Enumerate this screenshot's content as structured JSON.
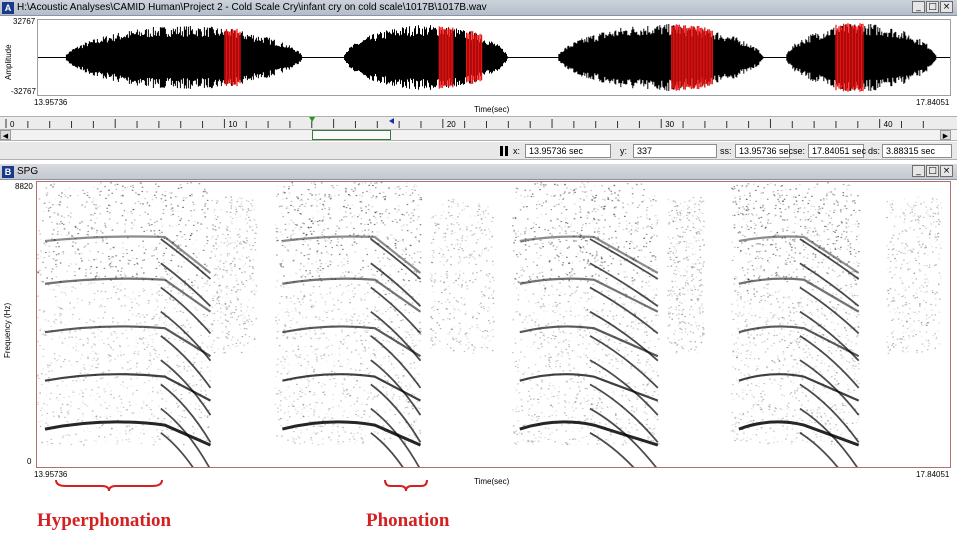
{
  "window_a": {
    "letter": "A",
    "title": "H:\\Acoustic Analyses\\CAMID Human\\Project 2 - Cold Scale Cry\\infant cry on cold scale\\1017B\\1017B.wav",
    "buttons": [
      "_",
      "□",
      "×"
    ]
  },
  "waveform": {
    "y_label": "Amplitude",
    "y_max": "32767",
    "y_min": "-32767",
    "x_start": "13.95736",
    "x_end": "17.84051",
    "x_label": "Time(sec)",
    "bursts": [
      {
        "start": 0.03,
        "end": 0.29,
        "amp": 0.9,
        "red": [
          [
            0.205,
            0.222
          ]
        ]
      },
      {
        "start": 0.335,
        "end": 0.515,
        "amp": 0.93,
        "red": [
          [
            0.44,
            0.455
          ],
          [
            0.47,
            0.488
          ]
        ]
      },
      {
        "start": 0.57,
        "end": 0.795,
        "amp": 0.95,
        "red": [
          [
            0.695,
            0.74
          ]
        ]
      },
      {
        "start": 0.82,
        "end": 0.985,
        "amp": 0.97,
        "red": [
          [
            0.875,
            0.905
          ]
        ]
      }
    ]
  },
  "ruler": {
    "labels": [
      {
        "text": "0",
        "pos": 0.0
      },
      {
        "text": "10",
        "pos": 0.2326
      },
      {
        "text": "20",
        "pos": 0.4652
      },
      {
        "text": "30",
        "pos": 0.6978
      },
      {
        "text": "40",
        "pos": 0.9304
      }
    ],
    "selection_start": 0.326,
    "selection_end": 0.41
  },
  "status": {
    "x_label": "x:",
    "x_value": "13.95736 sec",
    "y_label": "y:",
    "y_value": "337",
    "ss_label": "ss:",
    "ss_value": "13.95736 sec",
    "se_label": "se:",
    "se_value": "17.84051 sec",
    "ds_label": "ds:",
    "ds_value": "3.88315 sec"
  },
  "window_b": {
    "letter": "B",
    "title": "SPG",
    "buttons": [
      "_",
      "□",
      "×"
    ]
  },
  "spectrogram": {
    "y_label": "Frequency (Hz)",
    "y_max": "8820",
    "y_min": "0",
    "x_start": "13.95736",
    "x_end": "17.84051",
    "x_label": "Time(sec)"
  },
  "annotations": {
    "hyperphonation": "Hyperphonation",
    "phonation": "Phonation",
    "color": "#d42020"
  }
}
